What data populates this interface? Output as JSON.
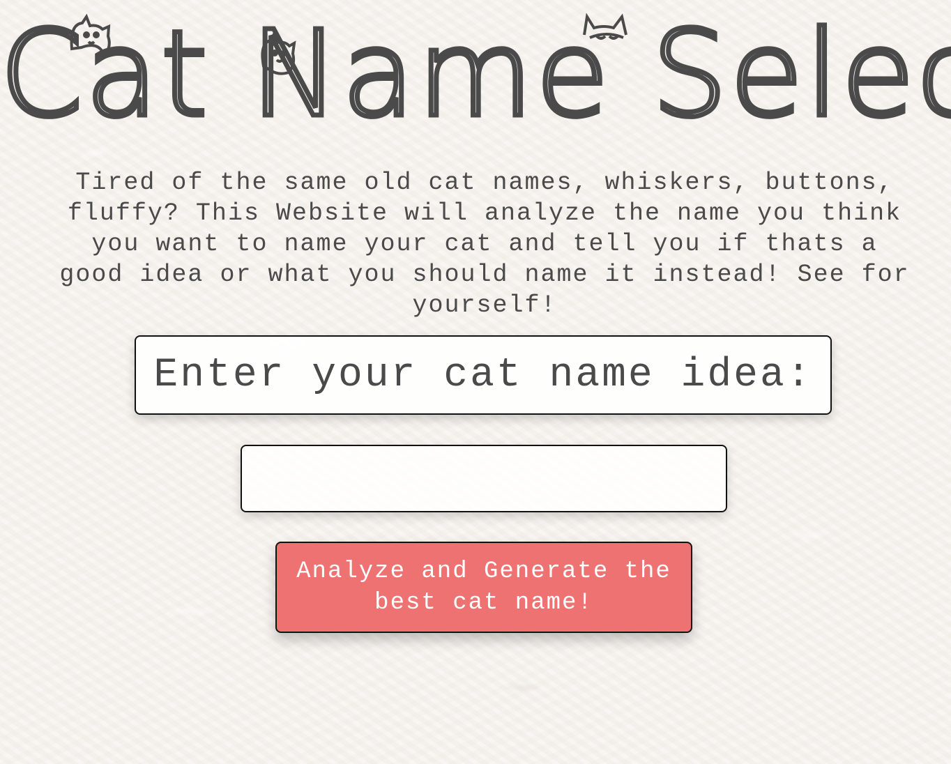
{
  "page": {
    "title": "Cat Name Selector",
    "intro": "Tired of the same old cat names, whiskers, buttons, fluffy? This Website will analyze the name you think you want to name your cat and tell you if thats a good idea or what you should name it instead! See for yourself!"
  },
  "form": {
    "prompt_label": "Enter your cat name idea:",
    "name_input_value": "",
    "name_input_placeholder": "",
    "submit_label": "Analyze and Generate the best cat name!"
  },
  "colors": {
    "background": "#f5f1ec",
    "text": "#4a4a4a",
    "button": "#ee7272",
    "button_text": "#ffffff",
    "border": "#111111"
  },
  "icons": [
    "cat-icon-c",
    "cat-icon-n",
    "cat-icon-s"
  ]
}
